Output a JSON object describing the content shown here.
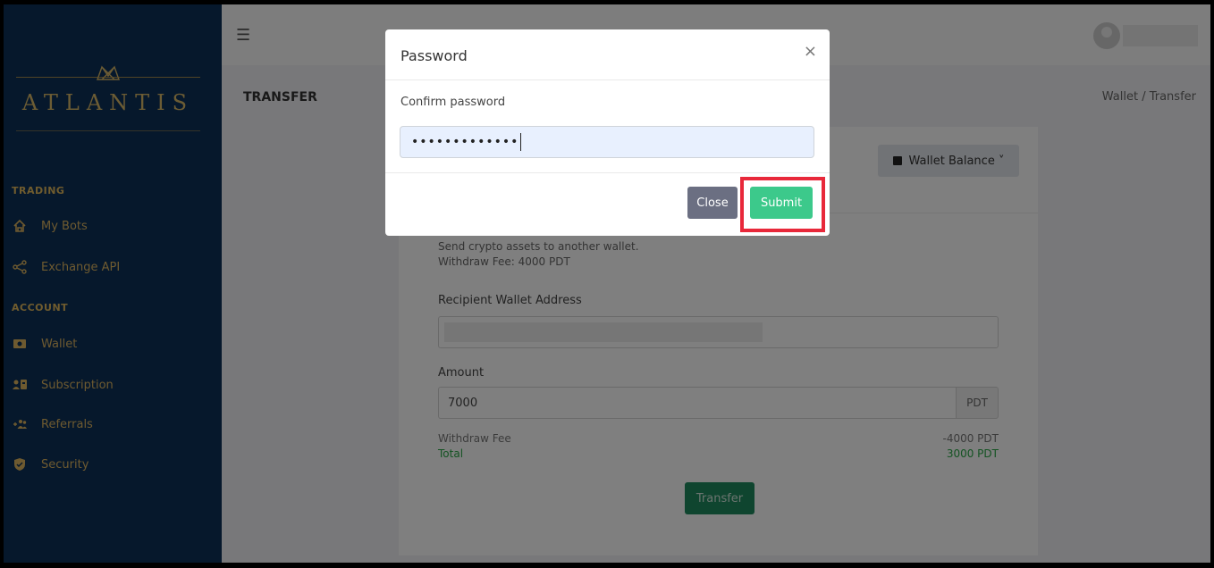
{
  "brand": {
    "name": "ATLANTIS"
  },
  "sidebar": {
    "sections": [
      {
        "label": "TRADING",
        "items": [
          {
            "label": "My Bots",
            "icon": "home-icon"
          },
          {
            "label": "Exchange API",
            "icon": "share-icon"
          }
        ]
      },
      {
        "label": "ACCOUNT",
        "items": [
          {
            "label": "Wallet",
            "icon": "wallet-icon"
          },
          {
            "label": "Subscription",
            "icon": "subscription-icon"
          },
          {
            "label": "Referrals",
            "icon": "referrals-icon"
          },
          {
            "label": "Security",
            "icon": "shield-icon"
          }
        ]
      }
    ]
  },
  "topbar": {
    "menu_icon": "☰"
  },
  "page": {
    "title": "TRANSFER",
    "breadcrumb": "Wallet  /  Transfer"
  },
  "card": {
    "wallet_button": "Wallet Balance ˅",
    "description": "Send crypto assets to another wallet.",
    "withdraw_fee_note": "Withdraw Fee: 4000 PDT",
    "recipient_label": "Recipient Wallet Address",
    "amount_label": "Amount",
    "amount_value": "7000",
    "currency": "PDT",
    "fee_label": "Withdraw Fee",
    "fee_value": "-4000 PDT",
    "total_label": "Total",
    "total_value": "3000 PDT",
    "transfer_button": "Transfer"
  },
  "modal": {
    "title": "Password",
    "close_icon": "×",
    "field_label": "Confirm password",
    "password_mask": "•••••••••••••",
    "close_button": "Close",
    "submit_button": "Submit"
  },
  "colors": {
    "sidebar_bg": "#0d3159",
    "sidebar_text": "#dcb460",
    "submit": "#3cc98b",
    "transfer": "#1e8a5e",
    "highlight": "#e8283a",
    "total_green": "#28a745"
  }
}
